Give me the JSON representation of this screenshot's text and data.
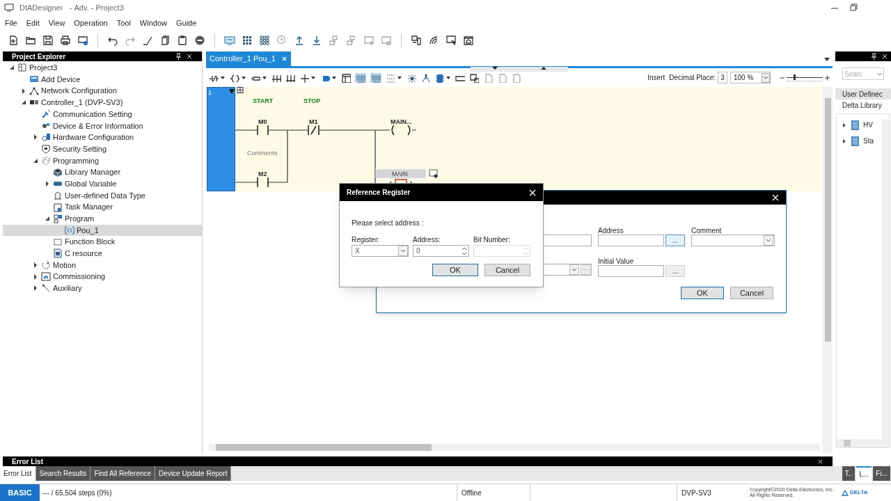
{
  "window": {
    "title": "DIADesigner",
    "subtitle": "- Adv. - Project3"
  },
  "menu": [
    "File",
    "Edit",
    "View",
    "Operation",
    "Tool",
    "Window",
    "Guide"
  ],
  "project_explorer": {
    "title": "Project Explorer",
    "tree": [
      {
        "label": "Project3",
        "expanded": true,
        "selected": false,
        "children": [
          {
            "label": "Add Device",
            "selected": false
          },
          {
            "label": "Network Configuration",
            "expanded": false,
            "selected": false
          },
          {
            "label": "Controller_1 (DVP-SV3)",
            "expanded": true,
            "selected": false,
            "children": [
              {
                "label": "Communication Setting",
                "selected": false
              },
              {
                "label": "Device & Error Information",
                "selected": false
              },
              {
                "label": "Hardware Configuration",
                "expanded": false,
                "selected": false
              },
              {
                "label": "Security Setting",
                "selected": false
              },
              {
                "label": "Programming",
                "expanded": true,
                "selected": false,
                "children": [
                  {
                    "label": "Library Manager",
                    "selected": false
                  },
                  {
                    "label": "Global Variable",
                    "expanded": false,
                    "selected": false
                  },
                  {
                    "label": "User-defined Data Type",
                    "selected": false
                  },
                  {
                    "label": "Task Manager",
                    "selected": false
                  },
                  {
                    "label": "Program",
                    "expanded": true,
                    "selected": false,
                    "children": [
                      {
                        "label": "Pou_1",
                        "selected": true
                      }
                    ]
                  },
                  {
                    "label": "Function Block",
                    "selected": false
                  },
                  {
                    "label": "C resource",
                    "selected": false
                  }
                ]
              },
              {
                "label": "Motion",
                "expanded": false,
                "selected": false
              },
              {
                "label": "Commissioning",
                "expanded": false,
                "selected": false
              },
              {
                "label": "Auxiliary",
                "expanded": false,
                "selected": false
              }
            ]
          }
        ]
      }
    ]
  },
  "editor": {
    "tabs": [
      {
        "label": "Controller_1 Pou_1",
        "selected": true
      }
    ],
    "toolbar": {
      "insert": "Insert",
      "decimal_label": "Decimal Place:",
      "decimal_value": "3",
      "zoom": "100 %",
      "zoom_slider": {
        "level": 0.2
      }
    },
    "ladder": {
      "rung_number": "1",
      "contacts": [
        {
          "kind": "no",
          "label": "START",
          "address": "M0"
        },
        {
          "kind": "nc",
          "label": "STOP",
          "address": "M1"
        },
        {
          "kind": "no",
          "address": "M2"
        }
      ],
      "coil": "MAIN...",
      "comment": "Comments",
      "input_value": "MAIN"
    }
  },
  "variable_dialog": {
    "address_label": "Address",
    "comment_label": "Comment",
    "initial_value_label": "Initial Value",
    "browse_buttons": [
      "...",
      "···",
      "..."
    ],
    "ok": "OK",
    "cancel": "Cancel"
  },
  "reference_dialog": {
    "title": "Reference Register",
    "prompt": "Please select address :",
    "register_label": "Register:",
    "register_value": "X",
    "address_label": "Address:",
    "address_value": "0",
    "bit_label": "Bit Number:",
    "bit_disabled": true,
    "ok": "OK",
    "cancel": "Cancel"
  },
  "library_panel": {
    "search_placeholder": "Searc",
    "tabs": [
      {
        "label": "User Definec",
        "selected": true
      },
      {
        "label": "Delta Library",
        "selected": false
      }
    ],
    "items": [
      "HV",
      "Sta"
    ]
  },
  "output_panel": {
    "title": "Error List",
    "tabs": [
      {
        "label": "Error List",
        "selected": true
      },
      {
        "label": "Search Results",
        "selected": false
      },
      {
        "label": "Find All Reference",
        "selected": false
      },
      {
        "label": "Device Update Report",
        "selected": false
      }
    ]
  },
  "side_tabs": [
    {
      "label": "T..",
      "selected": false
    },
    {
      "label": "L...",
      "selected": true
    },
    {
      "label": "Fi...",
      "selected": false
    }
  ],
  "status_bar": {
    "mode": "BASIC",
    "steps": "--- / 65,504 steps (0%)",
    "connection": "Offline",
    "model": "DVP-SV3",
    "copyright": [
      "Copyright©2020 Delta Electronics, Inc.",
      "All Rights Reserved."
    ],
    "logo": "DELTA"
  }
}
